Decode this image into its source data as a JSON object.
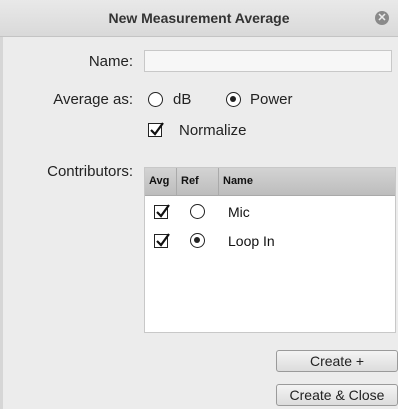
{
  "window": {
    "title": "New Measurement Average",
    "close_icon": "close-icon"
  },
  "form": {
    "name_label": "Name:",
    "name_value": "",
    "average_as_label": "Average as:",
    "average_options": [
      {
        "label": "dB",
        "selected": false
      },
      {
        "label": "Power",
        "selected": true
      }
    ],
    "normalize_label": "Normalize",
    "normalize_checked": true,
    "contributors_label": "Contributors:"
  },
  "contributors_table": {
    "columns": [
      "Avg",
      "Ref",
      "Name"
    ],
    "rows": [
      {
        "avg": true,
        "ref": false,
        "name": "Mic"
      },
      {
        "avg": true,
        "ref": true,
        "name": "Loop In"
      }
    ]
  },
  "buttons": {
    "create": "Create +",
    "create_close": "Create & Close"
  }
}
